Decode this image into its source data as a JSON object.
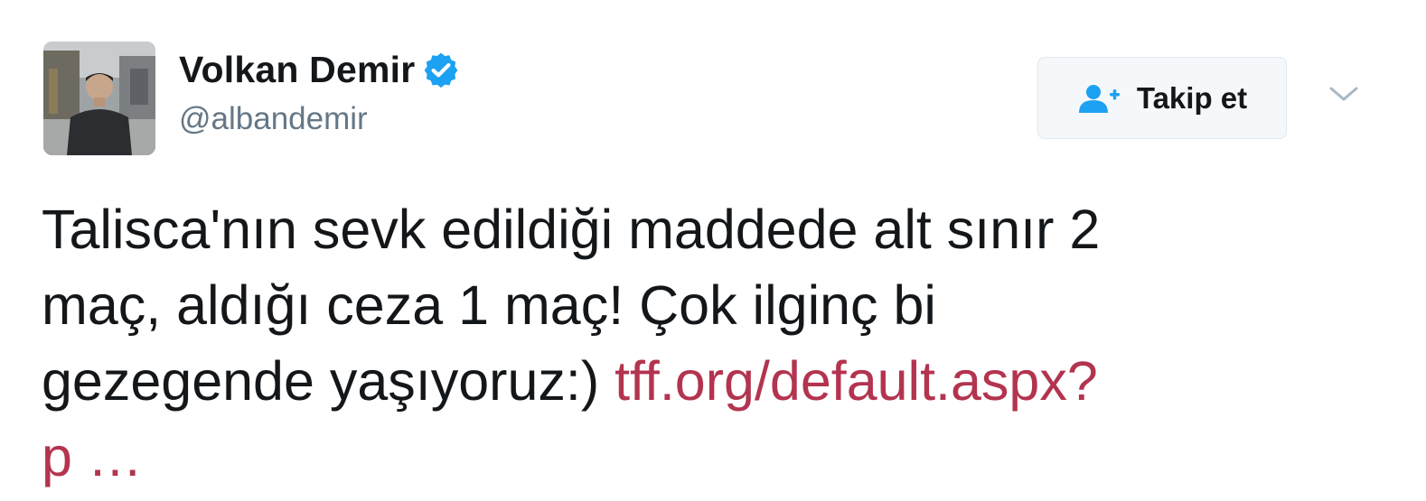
{
  "tweet": {
    "author": {
      "display_name": "Volkan Demir",
      "handle": "@albandemir",
      "verified": true
    },
    "follow_button": {
      "label": "Takip et"
    },
    "text_lines": [
      "Talisca'nın sevk edildiği maddede alt sınır 2",
      "maç, aldığı ceza 1 maç! Çok ilginç bi",
      "gezegende yaşıyoruz:) "
    ],
    "link_part1": "tff.org/default.aspx?",
    "link_part2": "p …"
  },
  "colors": {
    "text": "#14171a",
    "secondary": "#657786",
    "link": "#b3344f",
    "verified": "#1da1f2",
    "button_bg": "#f5f8fa"
  },
  "icons": {
    "verified": "verified-badge-icon",
    "follow": "add-person-icon",
    "menu": "chevron-down-icon"
  }
}
